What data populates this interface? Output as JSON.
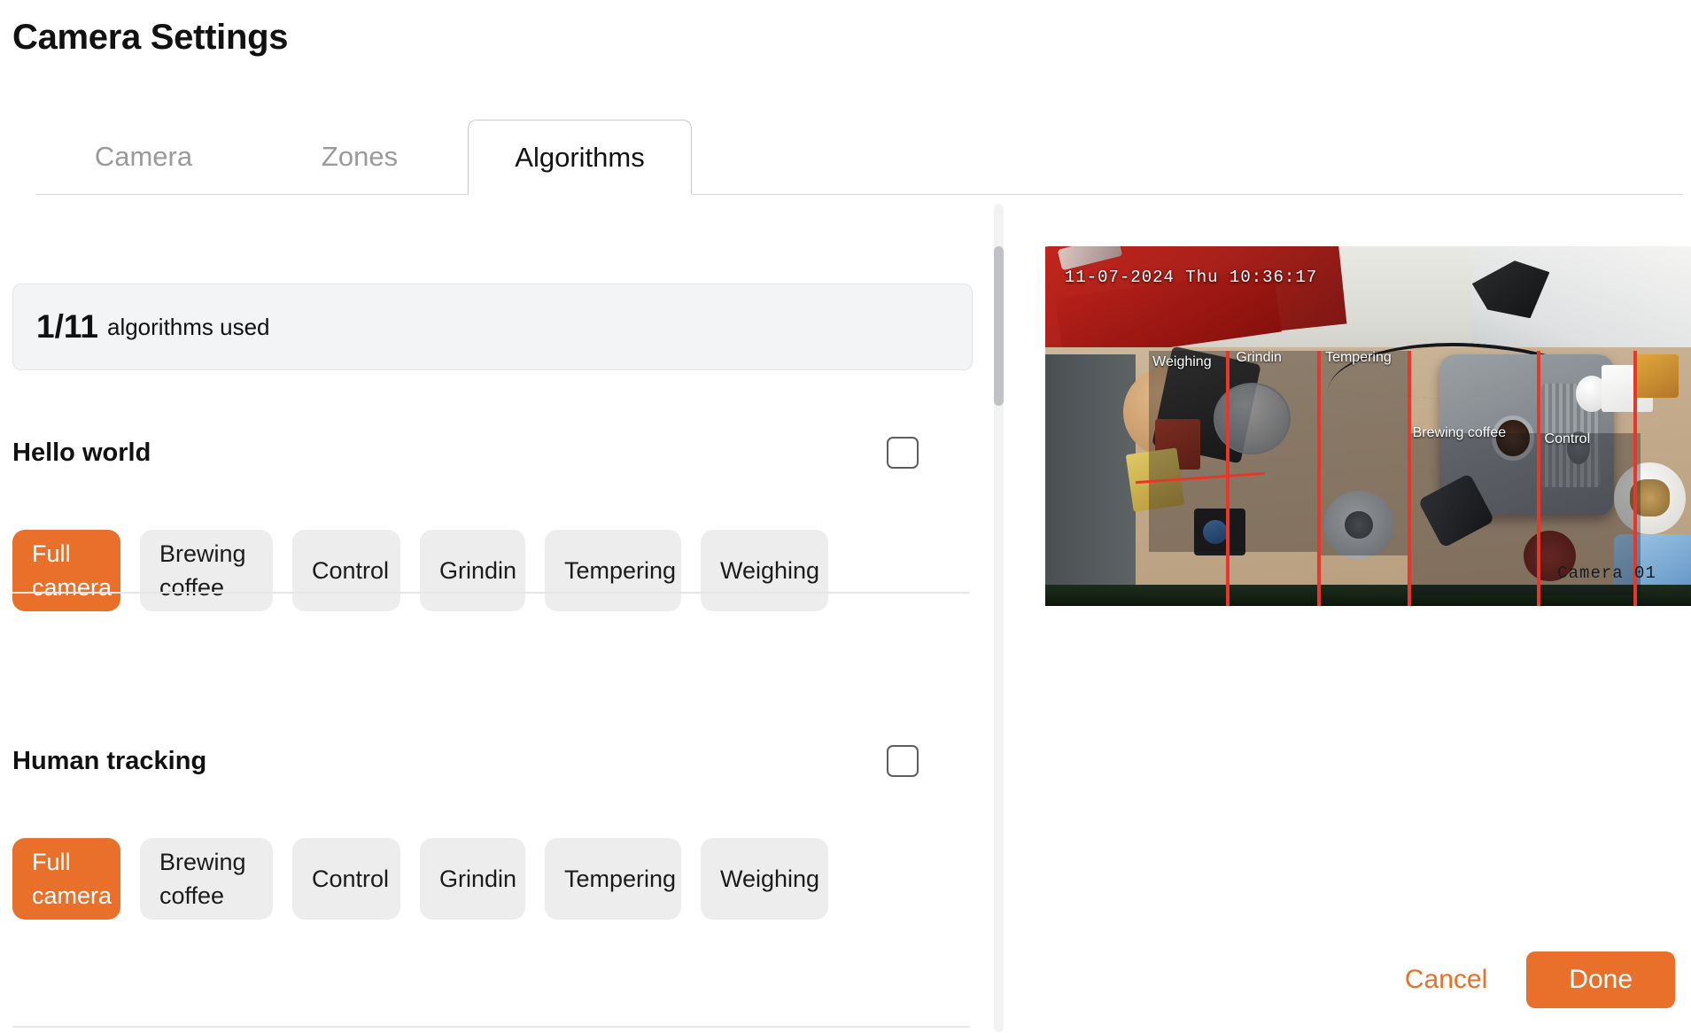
{
  "header": {
    "title": "Camera Settings"
  },
  "tabs": [
    {
      "label": "Camera",
      "active": false
    },
    {
      "label": "Zones",
      "active": false
    },
    {
      "label": "Algorithms",
      "active": true
    }
  ],
  "stats": {
    "count": "1/11",
    "label": "algorithms used"
  },
  "algorithms": [
    {
      "name": "Hello world",
      "enabled": false,
      "chips": [
        {
          "label": "Full\ncamera",
          "selected": true
        },
        {
          "label": "Brewing\ncoffee",
          "selected": false
        },
        {
          "label": "Control",
          "selected": false
        },
        {
          "label": "Grindin",
          "selected": false
        },
        {
          "label": "Tempering",
          "selected": false
        },
        {
          "label": "Weighing",
          "selected": false
        }
      ]
    },
    {
      "name": "Human tracking",
      "enabled": false,
      "chips": [
        {
          "label": "Full\ncamera",
          "selected": true
        },
        {
          "label": "Brewing\ncoffee",
          "selected": false
        },
        {
          "label": "Control",
          "selected": false
        },
        {
          "label": "Grindin",
          "selected": false
        },
        {
          "label": "Tempering",
          "selected": false
        },
        {
          "label": "Weighing",
          "selected": false
        }
      ]
    }
  ],
  "preview": {
    "timestamp": "11-07-2024 Thu 10:36:17",
    "camera_id": "Camera 01",
    "zone_labels": {
      "weighing": "Weighing",
      "grindin": "Grindin",
      "tempering": "Tempering",
      "brewing": "Brewing coffee",
      "control": "Control"
    }
  },
  "footer": {
    "cancel_label": "Cancel",
    "done_label": "Done"
  },
  "colors": {
    "accent": "#e8702a",
    "chip_bg": "#ededee",
    "zone_line": "#e8372a",
    "text": "#111111",
    "muted": "#9a9a9a"
  }
}
